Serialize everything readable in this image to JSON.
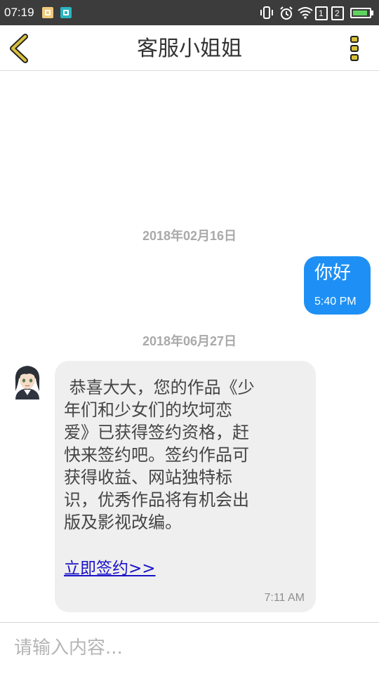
{
  "status_bar": {
    "time": "07:19",
    "sim1_label": "1",
    "sim2_label": "2",
    "battery_level": 0.9,
    "icons": [
      "notification-app-icon",
      "screenshot-app-icon",
      "vibrate-icon",
      "alarm-icon",
      "wifi-icon",
      "sim1-signal-icon",
      "sim2-signal-icon",
      "battery-charging-icon"
    ]
  },
  "header": {
    "title": "客服小姐姐",
    "back_icon": "chevron-left-icon",
    "menu_icon": "more-vertical-icon",
    "accent_color": "#d9c13a"
  },
  "messages": {
    "date_1": "2018年02月16日",
    "outgoing": {
      "text": "你好",
      "time": "5:40 PM",
      "color": "#1e90f5"
    },
    "date_2": "2018年06月27日",
    "incoming": {
      "text": " 恭喜大大，您的作品《少\n年们和少女们的坎坷恋\n爱》已获得签约资格，赶\n快来签约吧。签约作品可\n获得收益、网站独特标\n识，优秀作品将有机会出\n版及影视改编。",
      "link": "立即签约>>",
      "time": "7:11 AM",
      "color": "#efefef",
      "link_color": "#1a12c8"
    }
  },
  "input": {
    "placeholder": "请输入内容...",
    "value": ""
  }
}
